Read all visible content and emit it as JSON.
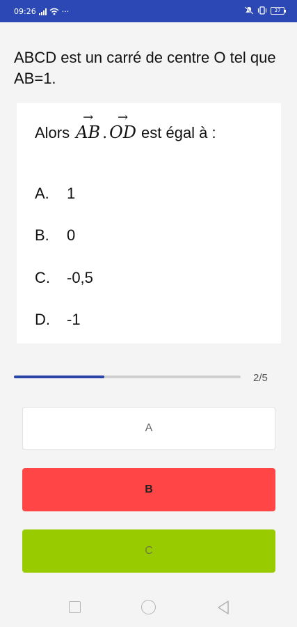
{
  "status_bar": {
    "time": "09:26",
    "notification_dots": "···",
    "battery": "37"
  },
  "question": {
    "text": "ABCD est un carré de centre O tel que AB=1.",
    "prompt_prefix": "Alors",
    "vector_1": "AB",
    "dot": ".",
    "vector_2": "OD",
    "prompt_suffix": "est égal à :",
    "arrow_glyph": "→"
  },
  "options": [
    {
      "letter": "A.",
      "value": "1"
    },
    {
      "letter": "B.",
      "value": "0"
    },
    {
      "letter": "C.",
      "value": "-0,5"
    },
    {
      "letter": "D.",
      "value": "-1"
    }
  ],
  "progress": {
    "label": "2/5",
    "fraction": 0.4
  },
  "answer_buttons": [
    {
      "label": "A",
      "color": "#ffffff"
    },
    {
      "label": "B",
      "color": "#ff4545"
    },
    {
      "label": "C",
      "color": "#99cc00"
    }
  ],
  "colors": {
    "status_bar": "#2b48b5",
    "progress": "#2a44a8"
  }
}
